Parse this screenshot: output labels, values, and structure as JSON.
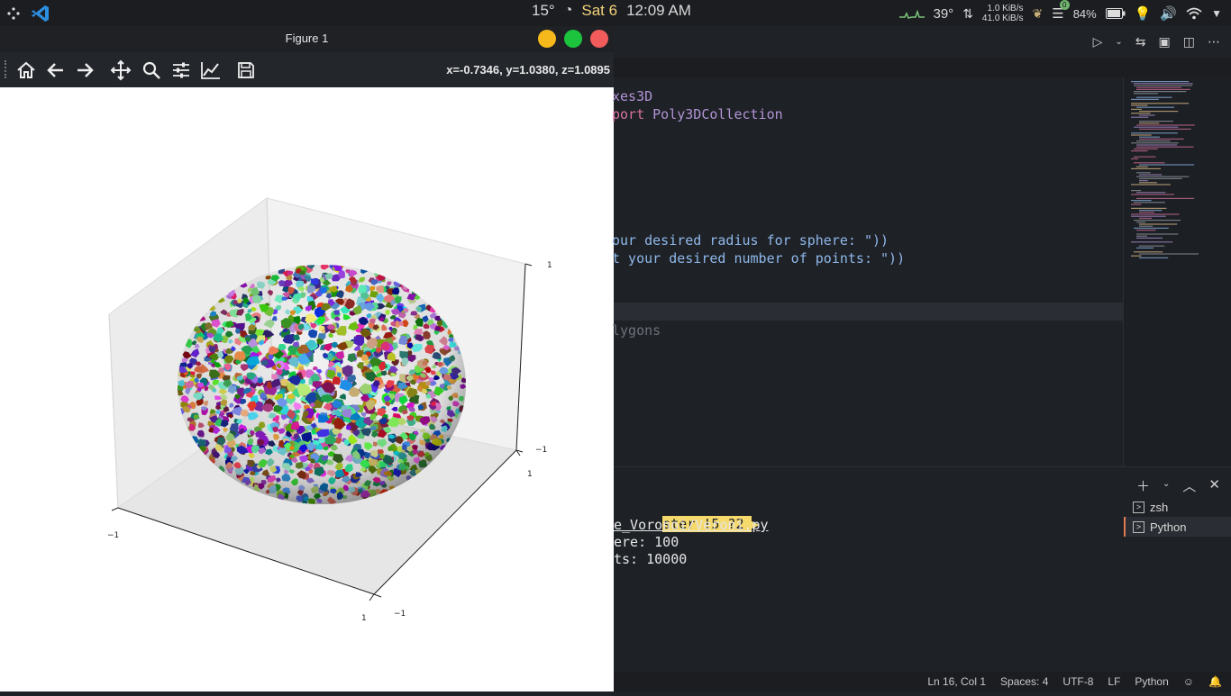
{
  "topbar": {
    "temperature": "15°",
    "date": "Sat 6",
    "time": "12:09 AM",
    "cpu_temp": "39°",
    "net_up": "1.0 KiB/s",
    "net_down": "41.0 KiB/s",
    "updates_badge": "0",
    "battery": "84%"
  },
  "figure": {
    "title": "Figure 1",
    "coords": "x=-0.7346, y=1.0380, z=1.0895",
    "toolbar_icons": [
      "home-icon",
      "back-arrow-icon",
      "forward-arrow-icon",
      "pan-icon",
      "zoom-icon",
      "configure-icon",
      "edit-axis-icon",
      "save-icon"
    ],
    "axis_ticks": {
      "z_top": "1",
      "z_bottom": "−1",
      "x_right_1": "1",
      "y_left": "−1",
      "x_bottom_1": "1",
      "x_bottom_neg": "−1"
    }
  },
  "editor": {
    "code_lines": [
      {
        "text": "xes3D",
        "color": "#b294d6"
      },
      {
        "text": "port Poly3DCollection",
        "color": "#d7729f"
      },
      {
        "text": "our desired radius for sphere: \"))",
        "color": "#8fb8ea"
      },
      {
        "text": "t your desired number of points: \"))",
        "color": "#8fb8ea"
      },
      {
        "text": "lygons",
        "color": "#6c717a"
      }
    ],
    "terminal": {
      "branch": "ster !5 ?2",
      "path": "e_Voronoi/Veroni.py",
      "line1": "ere: 100",
      "line2": "ts: 10000",
      "tabs": [
        "zsh",
        "Python"
      ]
    },
    "status": {
      "position": "Ln 16, Col 1",
      "spaces": "Spaces: 4",
      "encoding": "UTF-8",
      "eol": "LF",
      "language": "Python"
    }
  }
}
